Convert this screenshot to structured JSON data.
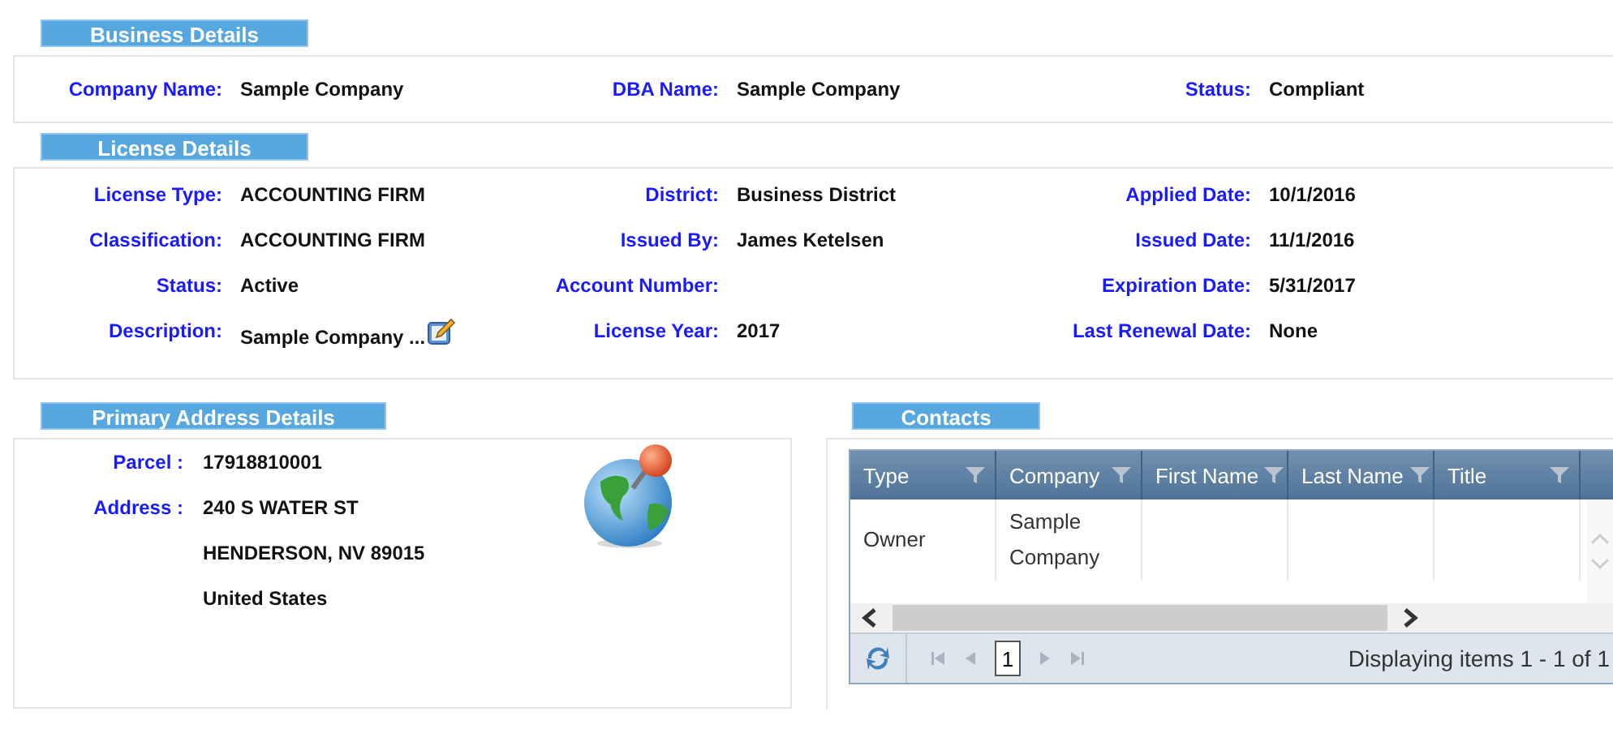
{
  "business": {
    "title": "Business Details",
    "fields": [
      {
        "label": "Company Name:",
        "value": "Sample Company"
      },
      {
        "label": "DBA Name:",
        "value": "Sample Company"
      },
      {
        "label": "Status:",
        "value": "Compliant"
      }
    ]
  },
  "license": {
    "title": "License Details",
    "fields": [
      {
        "label": "License Type:",
        "value": "ACCOUNTING FIRM"
      },
      {
        "label": "District:",
        "value": "Business District"
      },
      {
        "label": "Applied Date:",
        "value": "10/1/2016"
      },
      {
        "label": "Classification:",
        "value": "ACCOUNTING FIRM"
      },
      {
        "label": "Issued By:",
        "value": "James Ketelsen"
      },
      {
        "label": "Issued Date:",
        "value": "11/1/2016"
      },
      {
        "label": "Status:",
        "value": "Active"
      },
      {
        "label": "Account Number:"
      },
      {
        "label": "Expiration Date:",
        "value": "5/31/2017"
      },
      {
        "label": "Description:",
        "value": "Sample Company ...",
        "editable": true
      },
      {
        "label": "License Year:",
        "value": "2017"
      },
      {
        "label": "Last Renewal Date:",
        "value": "None"
      }
    ]
  },
  "address": {
    "title": "Primary Address Details",
    "parcel_label": "Parcel :",
    "parcel": "17918810001",
    "address_label": "Address :",
    "address_lines": [
      "240 S WATER ST",
      "HENDERSON, NV 89015",
      "United States"
    ]
  },
  "contacts": {
    "title": "Contacts",
    "columns": [
      "Type",
      "Company",
      "First Name",
      "Last Name",
      "Title"
    ],
    "rows": [
      [
        "Owner",
        "Sample Company",
        "",
        "",
        ""
      ]
    ],
    "pager": {
      "page": "1",
      "status": "Displaying items 1 - 1 of 1"
    }
  }
}
